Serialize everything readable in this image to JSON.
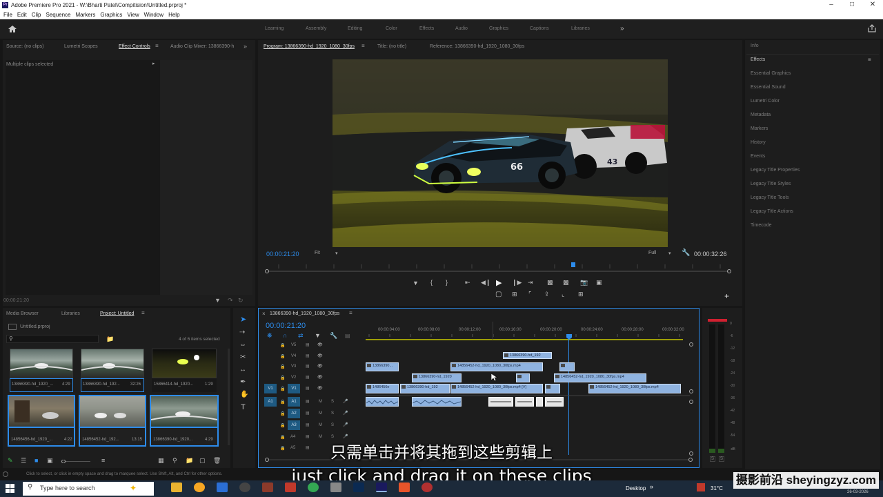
{
  "window": {
    "title": "Adobe Premiere Pro 2021 - W:\\Bharti Patel\\Compitision\\Untitled.prproj *",
    "app_icon": "Pr"
  },
  "menu": [
    "File",
    "Edit",
    "Clip",
    "Sequence",
    "Markers",
    "Graphics",
    "View",
    "Window",
    "Help"
  ],
  "workspaces": [
    "Learning",
    "Assembly",
    "Editing",
    "Color",
    "Effects",
    "Audio",
    "Graphics",
    "Captions",
    "Libraries"
  ],
  "source_panel": {
    "tabs": [
      "Source: (no clips)",
      "Lumetri Scopes",
      "Effect Controls",
      "Audio Clip Mixer: 13866390-h"
    ],
    "message": "Multiple clips selected",
    "timecode": "00:00:21:20"
  },
  "program_panel": {
    "tabs": [
      "Program: 13866390-hd_1920_1080_30fps",
      "Title: (no title)",
      "Reference: 13866390-hd_1920_1080_30fps"
    ],
    "timecode_left": "00:00:21:20",
    "fit": "Fit",
    "quality": "Full",
    "timecode_right": "00:00:32:26"
  },
  "right_panel": {
    "items": [
      "Info",
      "Effects",
      "Essential Graphics",
      "Essential Sound",
      "Lumetri Color",
      "Metadata",
      "Markers",
      "History",
      "Events",
      "Legacy Title Properties",
      "Legacy Title Styles",
      "Legacy Title Tools",
      "Legacy Title Actions",
      "Timecode"
    ]
  },
  "project_panel": {
    "tabs": [
      "Media Browser",
      "Libraries",
      "Project: Untitled"
    ],
    "file": "Untitled.prproj",
    "count": "4 of 6 items selected",
    "items": [
      {
        "name": "13866390-hd_1920_...",
        "dur": "4:29"
      },
      {
        "name": "13866390-hd_192...",
        "dur": "32:26"
      },
      {
        "name": "15866414-hd_1920...",
        "dur": "1:29"
      },
      {
        "name": "14856456-hd_1920_...",
        "dur": "4:22"
      },
      {
        "name": "14856452-hd_192...",
        "dur": "13:15"
      },
      {
        "name": "13866390-hd_1920...",
        "dur": "4:29"
      }
    ]
  },
  "timeline": {
    "sequence": "13866390-hd_1920_1080_30fps",
    "timecode": "00:00:21:20",
    "ruler": [
      "00:00:04:00",
      "00:00:08:00",
      "00:00:12:00",
      "00:00:16:00",
      "00:00:20:00",
      "00:00:24:00",
      "00:00:28:00",
      "00:00:32:00"
    ],
    "video_tracks": [
      "V5",
      "V4",
      "V3",
      "V2",
      "V1"
    ],
    "audio_tracks": [
      "A1",
      "A2",
      "A3",
      "A4",
      "A5"
    ],
    "v1_patch": "V1",
    "a1_patch": "A1",
    "clips": {
      "c1": "13866390...",
      "c2": "14856452-hd_1920_1080_30fps.mp4",
      "c3": "13866390-hd_192",
      "c4": "13866390-hd_1920",
      "c5": "14856452-hd_1920_1080_30fps.mp4",
      "c6": "1486456e",
      "c7": "13866390-hd_192",
      "c8": "14856452-hd_1920_1080_30fps.mp4 [V]",
      "c9": "14856452-hd_1920_1080_30fps.mp4"
    },
    "meter_labels": [
      "0",
      "-6",
      "-12",
      "-18",
      "-24",
      "-30",
      "-36",
      "-42",
      "-48",
      "-54",
      "-dB"
    ],
    "meter_sr": [
      "S",
      "S"
    ]
  },
  "status_bar": "Click to select, or click in empty space and drag to marquee select. Use Shift, Alt, and Ctrl for other options.",
  "subtitles": {
    "chinese": "只需单击并将其拖到这些剪辑上",
    "english": "just click and drag it on these clips"
  },
  "taskbar": {
    "search_placeholder": "Type here to search",
    "desktop": "Desktop",
    "temperature": "31°C",
    "date": "26-03-2026"
  },
  "watermark": "摄影前沿 sheyingzyz.com"
}
